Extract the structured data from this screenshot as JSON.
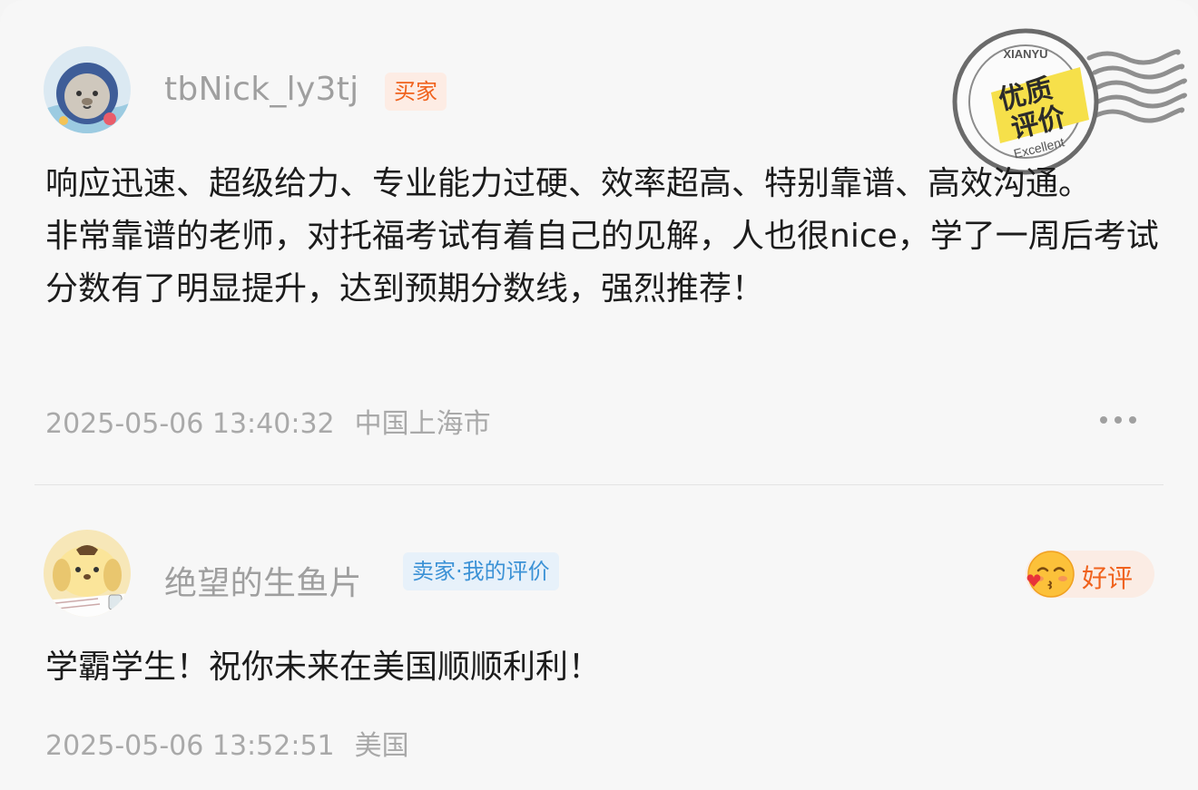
{
  "reviews": [
    {
      "username": "tbNick_ly3tj",
      "role_badge": "买家",
      "stamp": {
        "top_text": "XIANYU",
        "main_line1": "优质",
        "main_line2": "评价",
        "bottom_text": "Excellent"
      },
      "paragraphs": [
        "响应迅速、超级给力、专业能力过硬、效率超高、特别靠谱、高效沟通。",
        "非常靠谱的老师，对托福考试有着自己的见解，人也很nice，学了一周后考试分数有了明显提升，达到预期分数线，强烈推荐！"
      ],
      "timestamp": "2025-05-06 13:40:32",
      "location": "中国上海市"
    },
    {
      "username": "绝望的生鱼片",
      "role_badge": "卖家·我的评价",
      "rating_label": "好评",
      "paragraphs": [
        "学霸学生！祝你未来在美国顺顺利利！"
      ],
      "timestamp": "2025-05-06 13:52:51",
      "location": "美国"
    }
  ],
  "colors": {
    "accent_orange": "#f0621d",
    "accent_blue": "#3c92d6",
    "muted_text": "#a9a9a9",
    "background": "#f7f7f7"
  },
  "icons": {
    "more": "more-dots-icon",
    "rating": "kiss-face-icon",
    "stamp": "quality-stamp-icon"
  }
}
